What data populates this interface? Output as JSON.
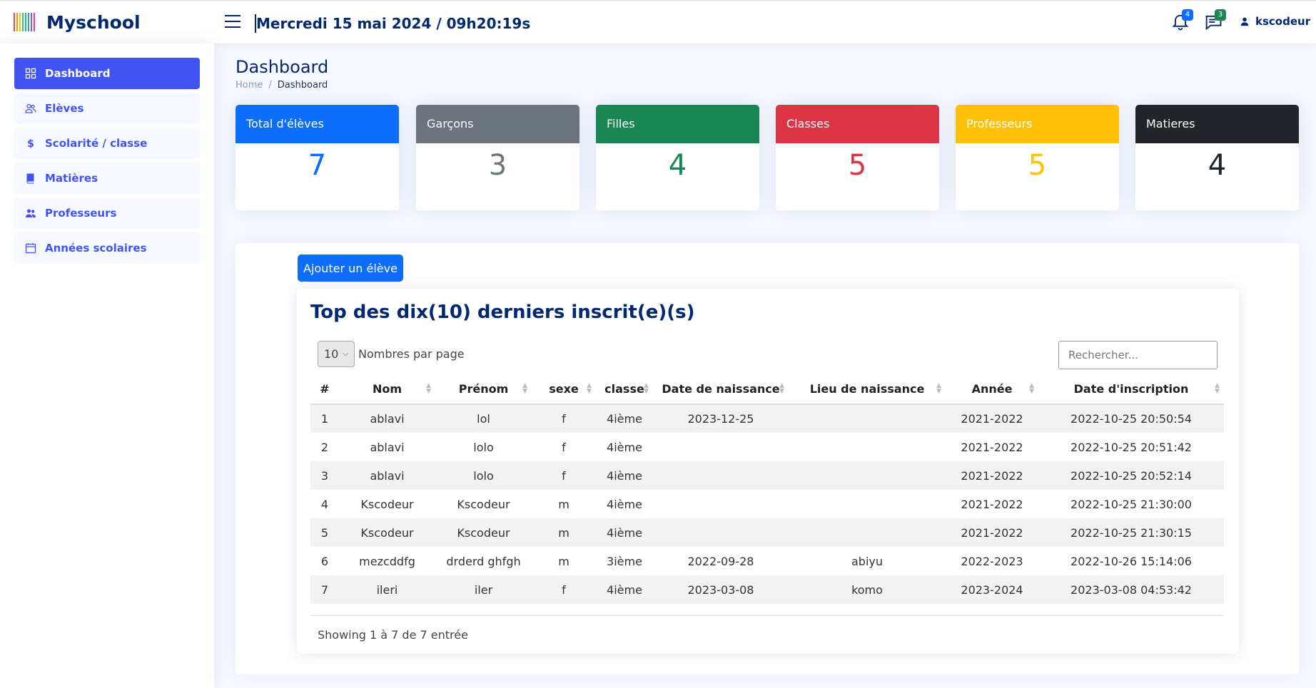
{
  "header": {
    "app_name": "Myschool",
    "datetime": "Mercredi 15 mai 2024 / 09h20:19s",
    "notifications_count": "4",
    "messages_count": "3",
    "username": "kscodeur",
    "colors": {
      "brand": "#012970",
      "notif_badge": "#0d6efd",
      "msg_badge": "#198754"
    }
  },
  "sidebar": {
    "items": [
      {
        "label": "Dashboard",
        "icon": "grid-icon",
        "active": true
      },
      {
        "label": "Elèves",
        "icon": "people-icon"
      },
      {
        "label": "Scolarité / classe",
        "icon": "dollar-icon"
      },
      {
        "label": "Matières",
        "icon": "book-icon"
      },
      {
        "label": "Professeurs",
        "icon": "people-fill-icon"
      },
      {
        "label": "Années scolaires",
        "icon": "calendar-icon"
      }
    ]
  },
  "page": {
    "title": "Dashboard",
    "breadcrumb": [
      "Home",
      "/",
      "Dashboard"
    ]
  },
  "stats": [
    {
      "label": "Total d'élèves",
      "value": "7",
      "color": "#0d6efd"
    },
    {
      "label": "Garçons",
      "value": "3",
      "color": "#6c757d"
    },
    {
      "label": "Filles",
      "value": "4",
      "color": "#198754"
    },
    {
      "label": "Classes",
      "value": "5",
      "color": "#dc3545"
    },
    {
      "label": "Professeurs",
      "value": "5",
      "color": "#ffc107"
    },
    {
      "label": "Matieres",
      "value": "4",
      "color": "#212529"
    }
  ],
  "students": {
    "add_button": "Ajouter un élève",
    "title": "Top des dix(10) derniers inscrit(e)(s)",
    "per_page": "10",
    "per_page_label": "Nombres par page",
    "search_placeholder": "Rechercher...",
    "columns": [
      "#",
      "Nom",
      "Prénom",
      "sexe",
      "classe",
      "Date de naissance",
      "Lieu de naissance",
      "Année",
      "Date d'inscription"
    ],
    "rows": [
      [
        "1",
        "ablavi",
        "lol",
        "f",
        "4ième",
        "2023-12-25",
        "",
        "2021-2022",
        "2022-10-25 20:50:54"
      ],
      [
        "2",
        "ablavi",
        "lolo",
        "f",
        "4ième",
        "",
        "",
        "2021-2022",
        "2022-10-25 20:51:42"
      ],
      [
        "3",
        "ablavi",
        "lolo",
        "f",
        "4ième",
        "",
        "",
        "2021-2022",
        "2022-10-25 20:52:14"
      ],
      [
        "4",
        "Kscodeur",
        "Kscodeur",
        "m",
        "4ième",
        "",
        "",
        "2021-2022",
        "2022-10-25 21:30:00"
      ],
      [
        "5",
        "Kscodeur",
        "Kscodeur",
        "m",
        "4ième",
        "",
        "",
        "2021-2022",
        "2022-10-25 21:30:15"
      ],
      [
        "6",
        "mezcddfg",
        "drderd ghfgh",
        "m",
        "3ième",
        "2022-09-28",
        "abiyu",
        "2022-2023",
        "2022-10-26 15:14:06"
      ],
      [
        "7",
        "ileri",
        "iler",
        "f",
        "4ième",
        "2023-03-08",
        "komo",
        "2023-2024",
        "2023-03-08 04:53:42"
      ]
    ],
    "footer": "Showing 1 à 7 de 7 entrée"
  }
}
